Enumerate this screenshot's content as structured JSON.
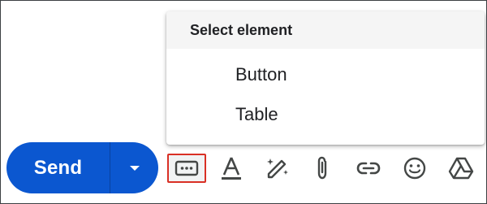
{
  "menu": {
    "header": "Select element",
    "items": [
      {
        "label": "Button"
      },
      {
        "label": "Table"
      }
    ]
  },
  "compose": {
    "send_label": "Send"
  },
  "toolbar": {
    "icons": [
      "insert-element-icon",
      "text-format-icon",
      "magic-write-icon",
      "attachment-icon",
      "link-icon",
      "emoji-icon",
      "drive-icon"
    ]
  },
  "colors": {
    "send_blue": "#0b57d0",
    "highlight_red": "#d93025",
    "icon_gray": "#444746"
  }
}
